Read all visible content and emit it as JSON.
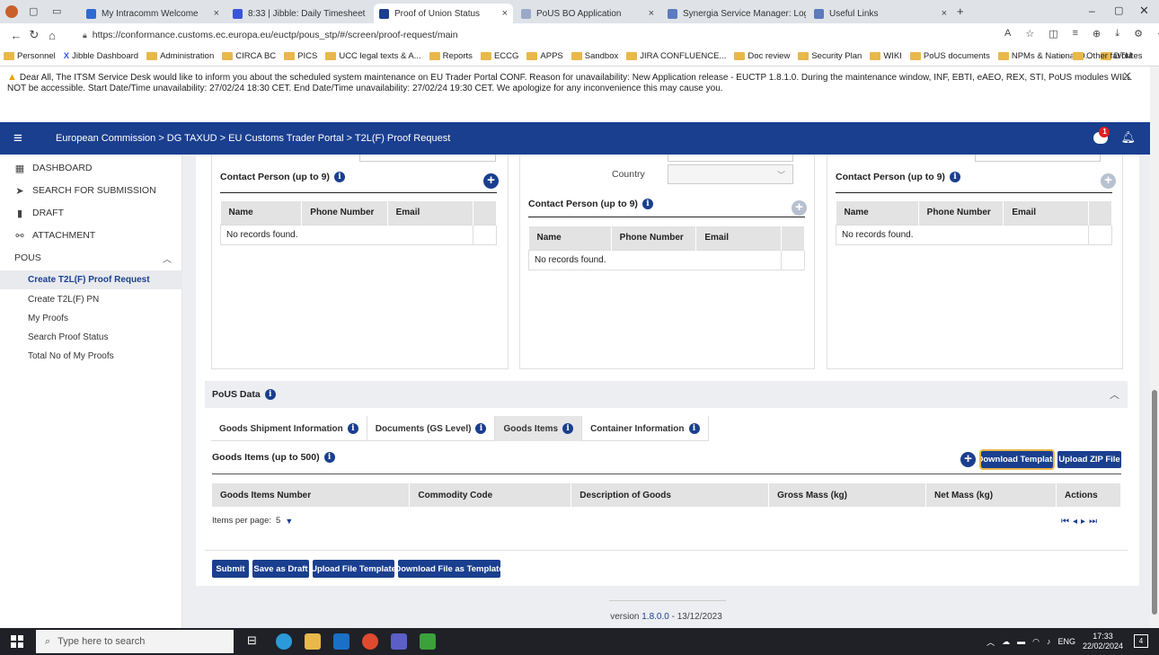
{
  "browser": {
    "tabs": [
      {
        "title": "My Intracomm Welcome",
        "color": "#2d6bd1"
      },
      {
        "title": "8:33 | Jibble: Daily Timesheet",
        "color": "#3a56d8"
      },
      {
        "title": "Proof of Union Status",
        "color": "#1a3f8f"
      },
      {
        "title": "PoUS BO Application",
        "color": "#9aa9c7"
      },
      {
        "title": "Synergia Service Manager: Login",
        "color": "#5b7bbf"
      },
      {
        "title": "Useful Links",
        "color": "#5b7bbf"
      }
    ],
    "url": "https://conformance.customs.ec.europa.eu/euctp/pous_stp/#/screen/proof-request/main",
    "favorites": [
      "Personnel",
      "Jibble Dashboard",
      "Administration",
      "CIRCA BC",
      "PICS",
      "UCC legal texts & A...",
      "Reports",
      "ECCG",
      "APPS",
      "Sandbox",
      "JIRA CONFLUENCE...",
      "Doc review",
      "Security Plan",
      "WIKI",
      "PoUS documents",
      "NPMs & National D...",
      "DTM"
    ],
    "other_favorites": "Other favorites"
  },
  "banner": {
    "text": "Dear All, The ITSM Service Desk would like to inform you about the scheduled system maintenance on EU Trader Portal CONF. Reason for unavailability: New Application release - EUCTP 1.8.1.0. During the maintenance window, INF, EBTI, eAEO, REX, STI, PoUS modules WILL NOT be accessible. Start Date/Time unavailability: 27/02/24 18:30 CET. End Date/Time unavailability: 27/02/24 19:30 CET. We apologize for any inconvenience this may cause you."
  },
  "header": {
    "breadcrumb": "European Commission > DG TAXUD > EU Customs Trader Portal > T2L(F) Proof Request",
    "notification_count": "1"
  },
  "sidebar": {
    "items": [
      {
        "label": "DASHBOARD",
        "icon": "dashboard-icon"
      },
      {
        "label": "SEARCH FOR SUBMISSION",
        "icon": "send-icon"
      },
      {
        "label": "DRAFT",
        "icon": "document-icon"
      },
      {
        "label": "ATTACHMENT",
        "icon": "link-icon"
      },
      {
        "label": "POUS",
        "icon": "chevron-up-icon"
      }
    ],
    "sub_items": [
      "Create T2L(F) Proof Request",
      "Create T2L(F) PN",
      "My Proofs",
      "Search Proof Status",
      "Total No of My Proofs"
    ]
  },
  "contacts": {
    "title": "Contact Person (up to 9)",
    "columns": [
      "Name",
      "Phone Number",
      "Email"
    ],
    "empty": "No records found.",
    "country_label": "Country"
  },
  "pous": {
    "title": "PoUS Data",
    "tabs": [
      "Goods Shipment Information",
      "Documents (GS Level)",
      "Goods Items",
      "Container Information"
    ],
    "goods_title": "Goods Items (up to 500)",
    "download_template": "Download Template",
    "upload_zip": "Upload ZIP File",
    "columns": [
      "Goods Items Number",
      "Commodity Code",
      "Description of Goods",
      "Gross Mass (kg)",
      "Net Mass (kg)",
      "Actions"
    ],
    "items_per_page_label": "Items per page:",
    "items_per_page": "5"
  },
  "actions": {
    "submit": "Submit",
    "save_draft": "Save as Draft",
    "upload_template": "Upload File Template",
    "download_template": "Download File as Template"
  },
  "footer": {
    "prefix": "version ",
    "version": "1.8.0.0",
    "date": " - 13/12/2023"
  },
  "taskbar": {
    "search_placeholder": "Type here to search",
    "lang": "ENG",
    "time": "17:33",
    "date": "22/02/2024",
    "notifications": "4"
  }
}
